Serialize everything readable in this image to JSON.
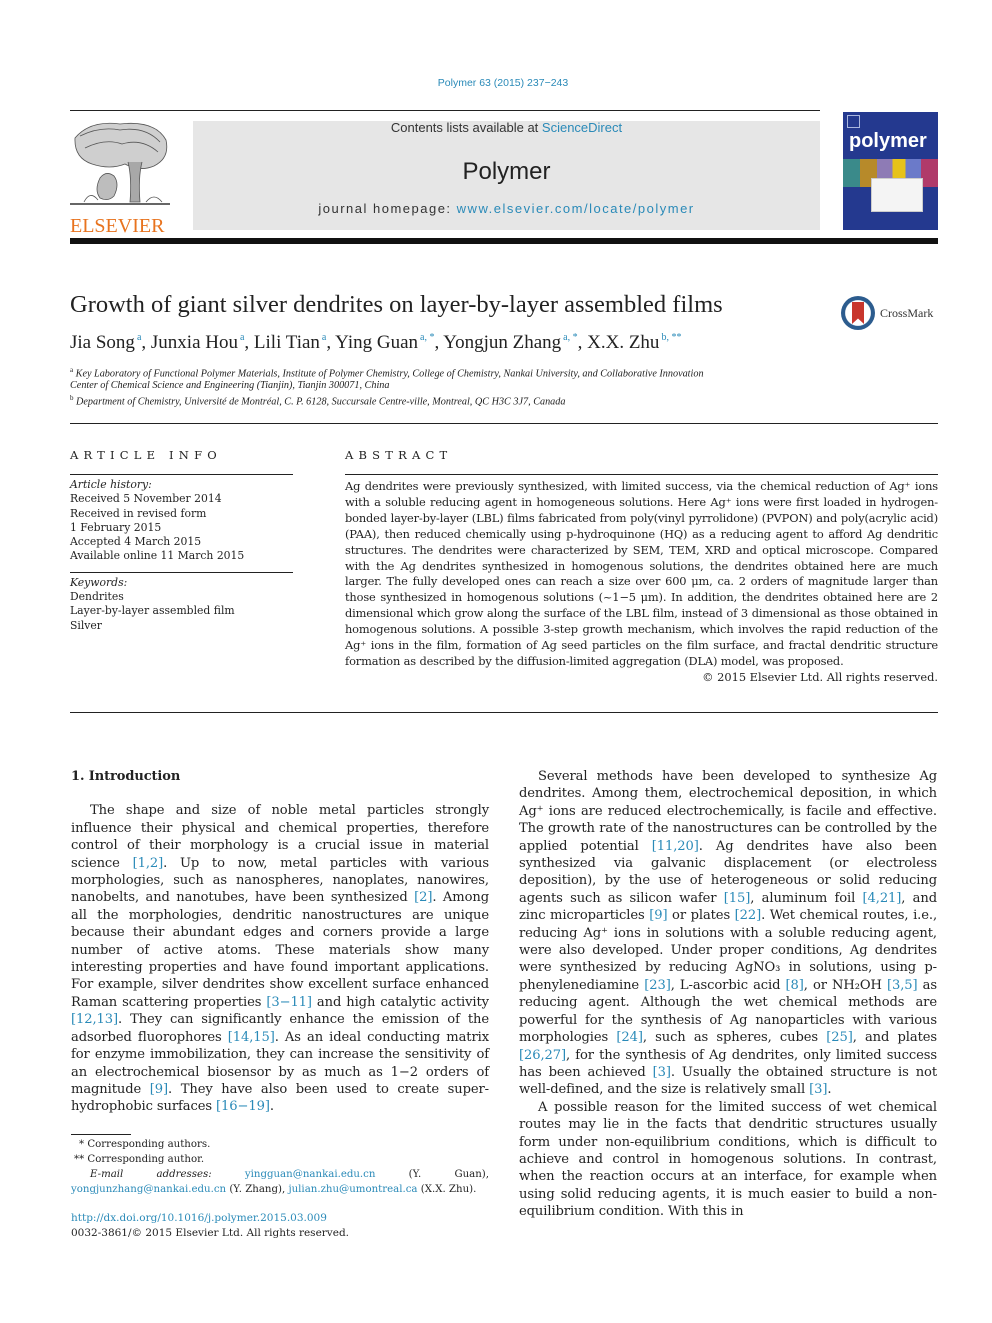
{
  "header": {
    "journal_ref": "Polymer 63 (2015) 237−243",
    "contents_prefix": "Contents lists available at ",
    "contents_link": "ScienceDirect",
    "journal_name": "Polymer",
    "homepage_prefix": "journal homepage: ",
    "homepage_link": "www.elsevier.com/locate/polymer",
    "publisher": "ELSEVIER",
    "cover_brand": "polymer",
    "brand_colors": {
      "elsevier_orange": "#e8731e",
      "link_blue": "#2a8ab8",
      "cover_blue": "#24398f"
    }
  },
  "article": {
    "title": "Growth of giant silver dendrites on layer-by-layer assembled films",
    "crossmark_label": "CrossMark",
    "authors": [
      {
        "name": "Jia Song",
        "sup": "a"
      },
      {
        "name": "Junxia Hou",
        "sup": "a"
      },
      {
        "name": "Lili Tian",
        "sup": "a"
      },
      {
        "name": "Ying Guan",
        "sup": "a, *"
      },
      {
        "name": "Yongjun Zhang",
        "sup": "a, *"
      },
      {
        "name": "X.X. Zhu",
        "sup": "b, **"
      }
    ],
    "affiliations": [
      {
        "mark": "a",
        "text": "Key Laboratory of Functional Polymer Materials, Institute of Polymer Chemistry, College of Chemistry, Nankai University, and Collaborative Innovation"
      },
      {
        "mark": "",
        "text": "Center of Chemical Science and Engineering (Tianjin), Tianjin 300071, China"
      },
      {
        "mark": "b",
        "text": "Department of Chemistry, Université de Montréal, C. P. 6128, Succursale Centre-ville, Montreal, QC H3C 3J7, Canada"
      }
    ]
  },
  "article_info": {
    "heading": "ARTICLE INFO",
    "history_label": "Article history:",
    "history": [
      "Received 5 November 2014",
      "Received in revised form",
      "1 February 2015",
      "Accepted 4 March 2015",
      "Available online 11 March 2015"
    ],
    "keywords_label": "Keywords:",
    "keywords": [
      "Dendrites",
      "Layer-by-layer assembled film",
      "Silver"
    ]
  },
  "abstract": {
    "heading": "ABSTRACT",
    "text": "Ag dendrites were previously synthesized, with limited success, via the chemical reduction of Ag⁺ ions with a soluble reducing agent in homogeneous solutions. Here Ag⁺ ions were first loaded in hydrogen-bonded layer-by-layer (LBL) films fabricated from poly(vinyl pyrrolidone) (PVPON) and poly(acrylic acid) (PAA), then reduced chemically using p-hydroquinone (HQ) as a reducing agent to afford Ag dendritic structures. The dendrites were characterized by SEM, TEM, XRD and optical microscope. Compared with the Ag dendrites synthesized in homogenous solutions, the dendrites obtained here are much larger. The fully developed ones can reach a size over 600 μm, ca. 2 orders of magnitude larger than those synthesized in homogenous solutions (~1−5 μm). In addition, the dendrites obtained here are 2 dimensional which grow along the surface of the LBL film, instead of 3 dimensional as those obtained in homogenous solutions. A possible 3-step growth mechanism, which involves the rapid reduction of the Ag⁺ ions in the film, formation of Ag seed particles on the film surface, and fractal dendritic structure formation as described by the diffusion-limited aggregation (DLA) model, was proposed.",
    "copyright": "© 2015 Elsevier Ltd. All rights reserved."
  },
  "body": {
    "section_heading": "1.  Introduction",
    "left_paragraph": [
      {
        "t": "The shape and size of noble metal particles strongly influence their physical and chemical properties, therefore control of their morphology is a crucial issue in material science "
      },
      {
        "ref": "[1,2]"
      },
      {
        "t": ". Up to now, metal particles with various morphologies, such as nanospheres, nanoplates, nanowires, nanobelts, and nanotubes, have been synthesized "
      },
      {
        "ref": "[2]"
      },
      {
        "t": ". Among all the morphologies, dendritic nanostructures are unique because their abundant edges and corners provide a large number of active atoms. These materials show many interesting properties and have found important applications. For example, silver dendrites show excellent surface enhanced Raman scattering properties "
      },
      {
        "ref": "[3−11]"
      },
      {
        "t": " and high catalytic activity "
      },
      {
        "ref": "[12,13]"
      },
      {
        "t": ". They can significantly enhance the emission of the adsorbed fluorophores "
      },
      {
        "ref": "[14,15]"
      },
      {
        "t": ". As an ideal conducting matrix for enzyme immobilization, they can increase the sensitivity of an electrochemical biosensor by as much as 1−2 orders of magnitude "
      },
      {
        "ref": "[9]"
      },
      {
        "t": ". They have also been used to create super-hydrophobic surfaces "
      },
      {
        "ref": "[16−19]"
      },
      {
        "t": "."
      }
    ],
    "right_paragraph_1": [
      {
        "t": "Several methods have been developed to synthesize Ag dendrites. Among them, electrochemical deposition, in which Ag⁺ ions are reduced electrochemically, is facile and effective. The growth rate of the nanostructures can be controlled by the applied potential "
      },
      {
        "ref": "[11,20]"
      },
      {
        "t": ". Ag dendrites have also been synthesized via galvanic displacement (or electroless deposition), by the use of heterogeneous or solid reducing agents such as silicon wafer "
      },
      {
        "ref": "[15]"
      },
      {
        "t": ", aluminum foil "
      },
      {
        "ref": "[4,21]"
      },
      {
        "t": ", and zinc microparticles "
      },
      {
        "ref": "[9]"
      },
      {
        "t": " or plates "
      },
      {
        "ref": "[22]"
      },
      {
        "t": ". Wet chemical routes, i.e., reducing Ag⁺ ions in solutions with a soluble reducing agent, were also developed. Under proper conditions, Ag dendrites were synthesized by reducing AgNO₃ in solutions, using p-phenylenediamine "
      },
      {
        "ref": "[23]"
      },
      {
        "t": ", L-ascorbic acid "
      },
      {
        "ref": "[8]"
      },
      {
        "t": ", or NH₂OH "
      },
      {
        "ref": "[3,5]"
      },
      {
        "t": " as reducing agent. Although the wet chemical methods are powerful for the synthesis of Ag nanoparticles with various morphologies "
      },
      {
        "ref": "[24]"
      },
      {
        "t": ", such as spheres, cubes "
      },
      {
        "ref": "[25]"
      },
      {
        "t": ", and plates "
      },
      {
        "ref": "[26,27]"
      },
      {
        "t": ", for the synthesis of Ag dendrites, only limited success has been achieved "
      },
      {
        "ref": "[3]"
      },
      {
        "t": ". Usually the obtained structure is not well-defined, and the size is relatively small "
      },
      {
        "ref": "[3]"
      },
      {
        "t": "."
      }
    ],
    "right_paragraph_2": "A possible reason for the limited success of wet chemical routes may lie in the facts that dendritic structures usually form under non-equilibrium conditions, which is difficult to achieve and control in homogenous solutions. In contrast, when the reaction occurs at an interface, for example when using solid reducing agents, it is much easier to build a non-equilibrium condition. With this in"
  },
  "footnotes": {
    "star1": "* Corresponding authors.",
    "star2": "** Corresponding author.",
    "email_label": "E-mail addresses: ",
    "emails": [
      {
        "addr": "yingguan@nankai.edu.cn",
        "who": " (Y. Guan), "
      },
      {
        "addr": "yongjunzhang@nankai.edu.cn",
        "who": " (Y. Zhang), "
      },
      {
        "addr": "julian.zhu@umontreal.ca",
        "who": " (X.X. Zhu)."
      }
    ],
    "doi": "http://dx.doi.org/10.1016/j.polymer.2015.03.009",
    "issn_line": "0032-3861/© 2015 Elsevier Ltd. All rights reserved."
  }
}
